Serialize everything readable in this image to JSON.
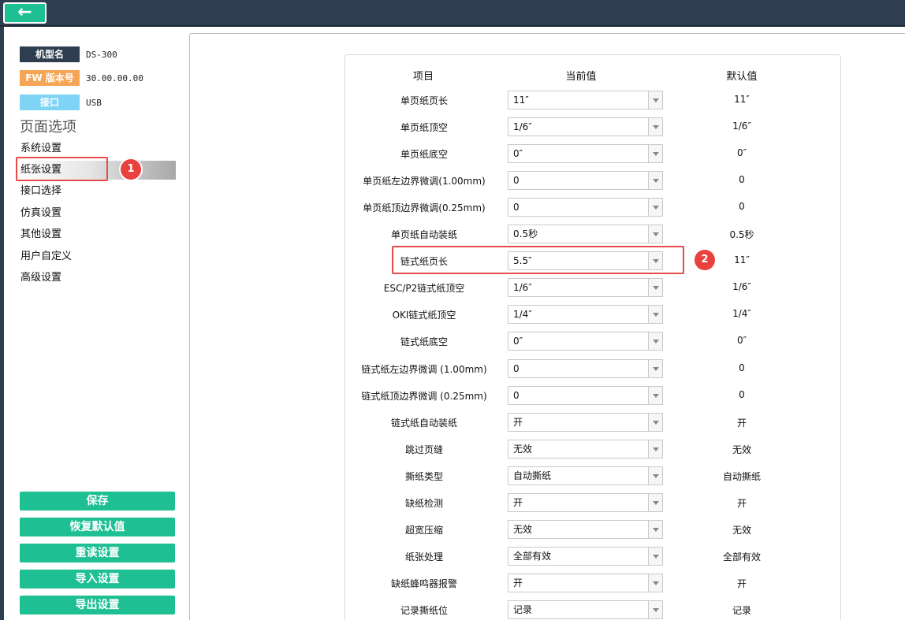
{
  "topbar": {
    "back_icon": "←"
  },
  "device": {
    "model_label": "机型名",
    "model_value": "DS-300",
    "fw_label": "FW 版本号",
    "fw_value": "30.00.00.00",
    "port_label": "接口",
    "port_value": "USB"
  },
  "colors": {
    "accent": "#1fbf94",
    "header": "#2e3e50",
    "model_tag": "#2e3e50",
    "fw_tag": "#f6a556",
    "port_tag": "#7fd3f4",
    "marker": "#e8413e"
  },
  "sidebar": {
    "section_title": "页面选项",
    "nav": [
      "系统设置",
      "纸张设置",
      "接口选择",
      "仿真设置",
      "其他设置",
      "用户自定义",
      "高级设置"
    ],
    "buttons": [
      "保存",
      "恢复默认值",
      "重读设置",
      "导入设置",
      "导出设置"
    ]
  },
  "markers": [
    "1",
    "2"
  ],
  "table": {
    "headers": [
      "项目",
      "当前值",
      "默认值"
    ],
    "rows": [
      {
        "item": "单页纸页长",
        "current": "11″",
        "default": "11″"
      },
      {
        "item": "单页纸顶空",
        "current": "1/6″",
        "default": "1/6″"
      },
      {
        "item": "单页纸底空",
        "current": "0″",
        "default": "0″"
      },
      {
        "item": "单页纸左边界微调(1.00mm)",
        "current": "0",
        "default": "0"
      },
      {
        "item": "单页纸顶边界微调(0.25mm)",
        "current": "0",
        "default": "0"
      },
      {
        "item": "单页纸自动装纸",
        "current": "0.5秒",
        "default": "0.5秒"
      },
      {
        "item": "链式纸页长",
        "current": "5.5″",
        "default": "11″"
      },
      {
        "item": "ESC/P2链式纸顶空",
        "current": "1/6″",
        "default": "1/6″"
      },
      {
        "item": "OKI链式纸顶空",
        "current": "1/4″",
        "default": "1/4″"
      },
      {
        "item": "链式纸底空",
        "current": "0″",
        "default": "0″"
      },
      {
        "item": "链式纸左边界微调 (1.00mm)",
        "current": "0",
        "default": "0"
      },
      {
        "item": "链式纸顶边界微调 (0.25mm)",
        "current": "0",
        "default": "0"
      },
      {
        "item": "链式纸自动装纸",
        "current": "开",
        "default": "开"
      },
      {
        "item": "跳过页缝",
        "current": "无效",
        "default": "无效"
      },
      {
        "item": "撕纸类型",
        "current": "自动撕纸",
        "default": "自动撕纸"
      },
      {
        "item": "缺纸检测",
        "current": "开",
        "default": "开"
      },
      {
        "item": "超宽压缩",
        "current": "无效",
        "default": "无效"
      },
      {
        "item": "纸张处理",
        "current": "全部有效",
        "default": "全部有效"
      },
      {
        "item": "缺纸蜂鸣器报警",
        "current": "开",
        "default": "开"
      },
      {
        "item": "记录撕纸位",
        "current": "记录",
        "default": "记录"
      }
    ]
  }
}
